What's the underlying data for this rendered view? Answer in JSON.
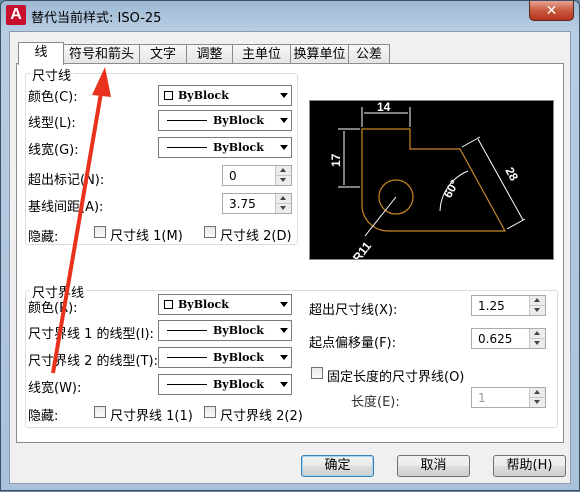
{
  "window": {
    "title": "替代当前样式: ISO-25",
    "icon_letter": "A",
    "close_label": "✕"
  },
  "tabs": [
    {
      "label": "线"
    },
    {
      "label": "符号和箭头"
    },
    {
      "label": "文字"
    },
    {
      "label": "调整"
    },
    {
      "label": "主单位"
    },
    {
      "label": "换算单位"
    },
    {
      "label": "公差"
    }
  ],
  "active_tab": "线",
  "dim_lines": {
    "title": "尺寸线",
    "color_label": "颜色(C):",
    "color_value": "ByBlock",
    "linetype_label": "线型(L):",
    "linetype_value": "ByBlock",
    "lineweight_label": "线宽(G):",
    "lineweight_value": "ByBlock",
    "extend_ticks_label": "超出标记(N):",
    "extend_ticks_value": "0",
    "baseline_spacing_label": "基线间距(A):",
    "baseline_spacing_value": "3.75",
    "suppress_label": "隐藏:",
    "suppress_1": "尺寸线 1(M)",
    "suppress_2": "尺寸线 2(D)"
  },
  "ext_lines": {
    "title": "尺寸界线",
    "color_label": "颜色(R):",
    "color_value": "ByBlock",
    "linetype1_label": "尺寸界线 1 的线型(I):",
    "linetype1_value": "ByBlock",
    "linetype2_label": "尺寸界线 2 的线型(T):",
    "linetype2_value": "ByBlock",
    "lineweight_label": "线宽(W):",
    "lineweight_value": "ByBlock",
    "suppress_label": "隐藏:",
    "suppress_1": "尺寸界线 1(1)",
    "suppress_2": "尺寸界线 2(2)",
    "extend_beyond_label": "超出尺寸线(X):",
    "extend_beyond_value": "1.25",
    "offset_label": "起点偏移量(F):",
    "offset_value": "0.625",
    "fixed_length_label": "固定长度的尺寸界线(O)",
    "length_label": "长度(E):",
    "length_value": "1"
  },
  "preview": {
    "dim_top": "14",
    "dim_left": "17",
    "dim_angle": "60°",
    "dim_right": "28",
    "dim_radius": "R11"
  },
  "buttons": {
    "ok": "确定",
    "cancel": "取消",
    "help": "帮助(H)"
  },
  "colors": {
    "annotation_arrow": "#e8321e",
    "preview_geometry": "#c8882a",
    "preview_bg": "#000000"
  }
}
